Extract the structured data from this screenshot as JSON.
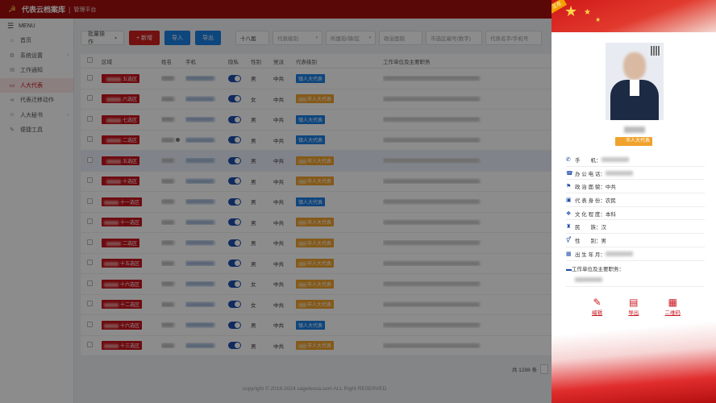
{
  "app": {
    "title": "代表云档案库",
    "subtitle": "管理平台"
  },
  "sidebar": {
    "menu_label": "MENU",
    "items": [
      {
        "label": "首页",
        "icon": "home-icon"
      },
      {
        "label": "系统设置",
        "icon": "gear-icon"
      },
      {
        "label": "工作通知",
        "icon": "mail-icon"
      },
      {
        "label": "人大代表",
        "icon": "folder-icon",
        "active": true
      },
      {
        "label": "代表迁移动作",
        "icon": "share-icon"
      },
      {
        "label": "人大秘书",
        "icon": "user-icon"
      },
      {
        "label": "便捷工具",
        "icon": "tool-icon"
      }
    ]
  },
  "toolbar": {
    "batch_label": "批量操作",
    "add_label": "+ 新增",
    "import_label": "导入",
    "export_label": "导出",
    "filters": [
      "十八届",
      "代表级别",
      "所属街/镇/区",
      "政治面貌",
      "市选区编号(数字)",
      "代表名字/手机号"
    ]
  },
  "table": {
    "headers": [
      "区域",
      "姓名",
      "手机",
      "隐私",
      "性别",
      "党派",
      "代表级别",
      "工作单位及主要职务"
    ],
    "rows": [
      {
        "area": "五选区",
        "gender": "男",
        "party": "中共",
        "level": "镇人大代表",
        "level_color": "blue"
      },
      {
        "area": "六选区",
        "gender": "女",
        "party": "中共",
        "level": "市人大代表",
        "level_color": "orange"
      },
      {
        "area": "七选区",
        "gender": "男",
        "party": "中共",
        "level": "镇人大代表",
        "level_color": "blue"
      },
      {
        "area": "二选区",
        "gender": "男",
        "party": "中共",
        "level": "镇人大代表",
        "level_color": "blue"
      },
      {
        "area": "五选区",
        "gender": "男",
        "party": "中共",
        "level": "市人大代表",
        "level_color": "orange",
        "highlight": true
      },
      {
        "area": "十选区",
        "gender": "男",
        "party": "中共",
        "level": "市人大代表",
        "level_color": "orange"
      },
      {
        "area": "十一选区",
        "gender": "男",
        "party": "中共",
        "level": "镇人大代表",
        "level_color": "blue"
      },
      {
        "area": "十一选区",
        "gender": "男",
        "party": "中共",
        "level": "市人大代表",
        "level_color": "orange"
      },
      {
        "area": "二选区",
        "gender": "男",
        "party": "中共",
        "level": "市人大代表",
        "level_color": "orange"
      },
      {
        "area": "十五选区",
        "gender": "男",
        "party": "中共",
        "level": "市人大代表",
        "level_color": "orange"
      },
      {
        "area": "十六选区",
        "gender": "女",
        "party": "中共",
        "level": "市人大代表",
        "level_color": "orange"
      },
      {
        "area": "十二选区",
        "gender": "女",
        "party": "中共",
        "level": "市人大代表",
        "level_color": "orange"
      },
      {
        "area": "十六选区",
        "gender": "男",
        "party": "中共",
        "level": "镇人大代表",
        "level_color": "blue"
      },
      {
        "area": "十三选区",
        "gender": "男",
        "party": "中共",
        "level": "市人大代表",
        "level_color": "orange"
      }
    ]
  },
  "pager": {
    "total": "共 1288 条"
  },
  "footer": {
    "copyright": "copyright © 2018-2024 sagetessa.com ALL Right RESERVED"
  },
  "panel": {
    "corner": "正在",
    "badge": "市人大代表",
    "info": [
      {
        "icon": "phone-icon",
        "label": "手　　机：",
        "value": ""
      },
      {
        "icon": "telephone-icon",
        "label": "办 公 电 话：",
        "value": ""
      },
      {
        "icon": "flag-icon",
        "label": "政 治 面 貌：",
        "value": "中共"
      },
      {
        "icon": "id-card-icon",
        "label": "代 表 身 份：",
        "value": "农民"
      },
      {
        "icon": "book-icon",
        "label": "文 化 程 度：",
        "value": "本科"
      },
      {
        "icon": "shirt-icon",
        "label": "民　　族：",
        "value": "汉"
      },
      {
        "icon": "gender-icon",
        "label": "性　　别：",
        "value": "男"
      },
      {
        "icon": "calendar-icon",
        "label": "出 生 年 月：",
        "value": ""
      },
      {
        "icon": "briefcase-icon",
        "label": "工作单位及主要职务：",
        "value": ""
      }
    ],
    "actions": [
      {
        "label": "编辑",
        "icon": "edit-icon"
      },
      {
        "label": "导出",
        "icon": "pdf-icon"
      },
      {
        "label": "二维码",
        "icon": "qrcode-icon"
      }
    ]
  }
}
